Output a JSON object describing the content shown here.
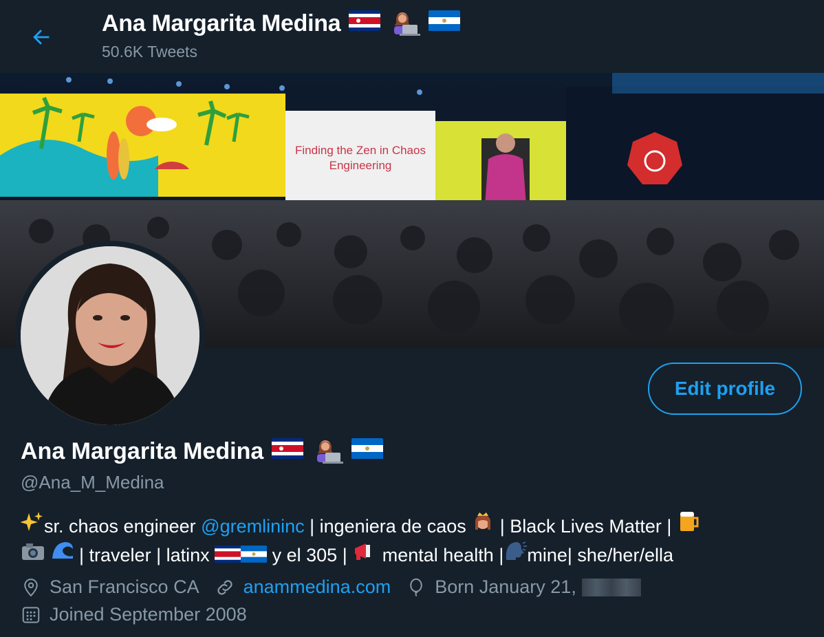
{
  "header": {
    "title": "Ana Margarita Medina",
    "tweet_count": "50.6K Tweets"
  },
  "banner": {
    "slide_title": "Finding the Zen in Chaos Engineering"
  },
  "profile": {
    "name": "Ana Margarita Medina",
    "handle": "@Ana_M_Medina",
    "edit_button_label": "Edit profile",
    "bio_line1": {
      "a": "sr. chaos engineer ",
      "mention": "@gremlininc",
      "b": " | ingeniera de caos ",
      "c": " | Black Lives Matter | "
    },
    "bio_line2": {
      "a": " | traveler | latinx ",
      "b": " y el 305 | ",
      "c": " mental health |",
      "d": "mine| she/her/ella"
    },
    "location": "San Francisco CA",
    "website": "anammedina.com",
    "birthday": "Born January 21,",
    "joined": "Joined September 2008"
  },
  "icons": [
    "back-arrow-icon",
    "flag-costa-rica-icon",
    "technologist-emoji-icon",
    "flag-nicaragua-icon",
    "sparkles-emoji-icon",
    "princess-emoji-icon",
    "beer-emoji-icon",
    "camera-emoji-icon",
    "wave-emoji-icon",
    "megaphone-emoji-icon",
    "speaking-head-emoji-icon",
    "location-pin-icon",
    "link-icon",
    "balloon-icon",
    "calendar-icon"
  ],
  "colors": {
    "background": "#15202b",
    "accent": "#1da1f2",
    "secondary_text": "#8899a6"
  }
}
